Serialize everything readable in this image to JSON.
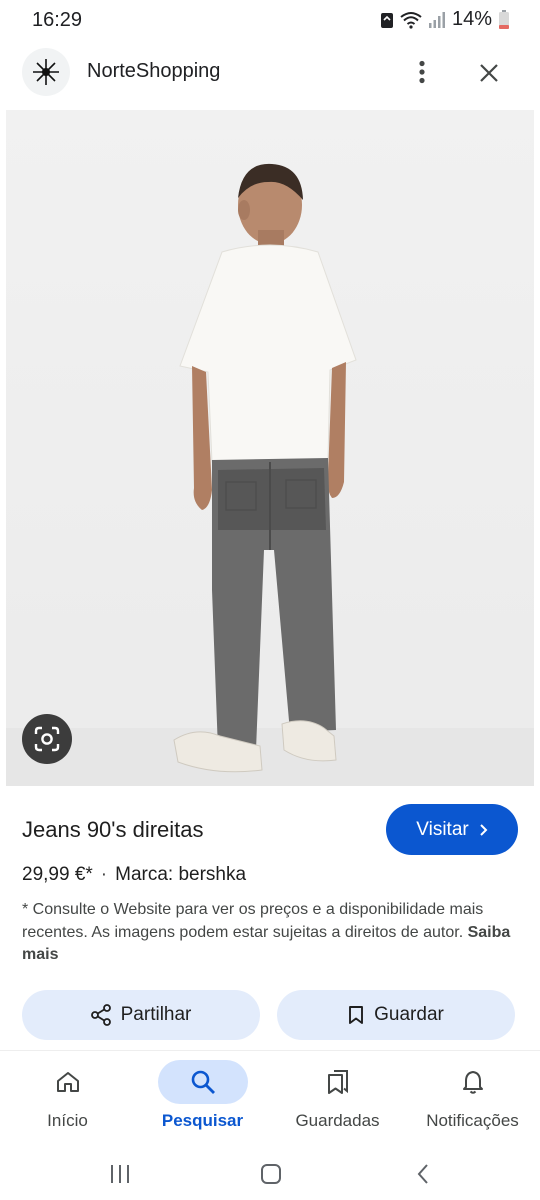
{
  "status_bar": {
    "time": "16:29",
    "battery": "14%"
  },
  "header": {
    "site_name": "NorteShopping"
  },
  "product": {
    "title": "Jeans 90's direitas",
    "visit_label": "Visitar",
    "price": "29,99 €*",
    "separator": "·",
    "brand": "Marca: bershka",
    "disclaimer": "* Consulte o Website para ver os preços e a disponibilidade mais recentes. As imagens podem estar sujeitas a direitos de autor.",
    "learn_more": "Saiba mais"
  },
  "actions": {
    "share_label": "Partilhar",
    "save_label": "Guardar"
  },
  "bottom_nav": {
    "items": [
      {
        "label": "Início",
        "icon": "home-icon"
      },
      {
        "label": "Pesquisar",
        "icon": "search-icon",
        "active": true
      },
      {
        "label": "Guardadas",
        "icon": "bookmarks-icon"
      },
      {
        "label": "Notificações",
        "icon": "bell-icon"
      }
    ]
  },
  "colors": {
    "accent": "#0b57d0",
    "accent_light": "#d3e3fd",
    "chip_bg": "#e3ecfb"
  }
}
